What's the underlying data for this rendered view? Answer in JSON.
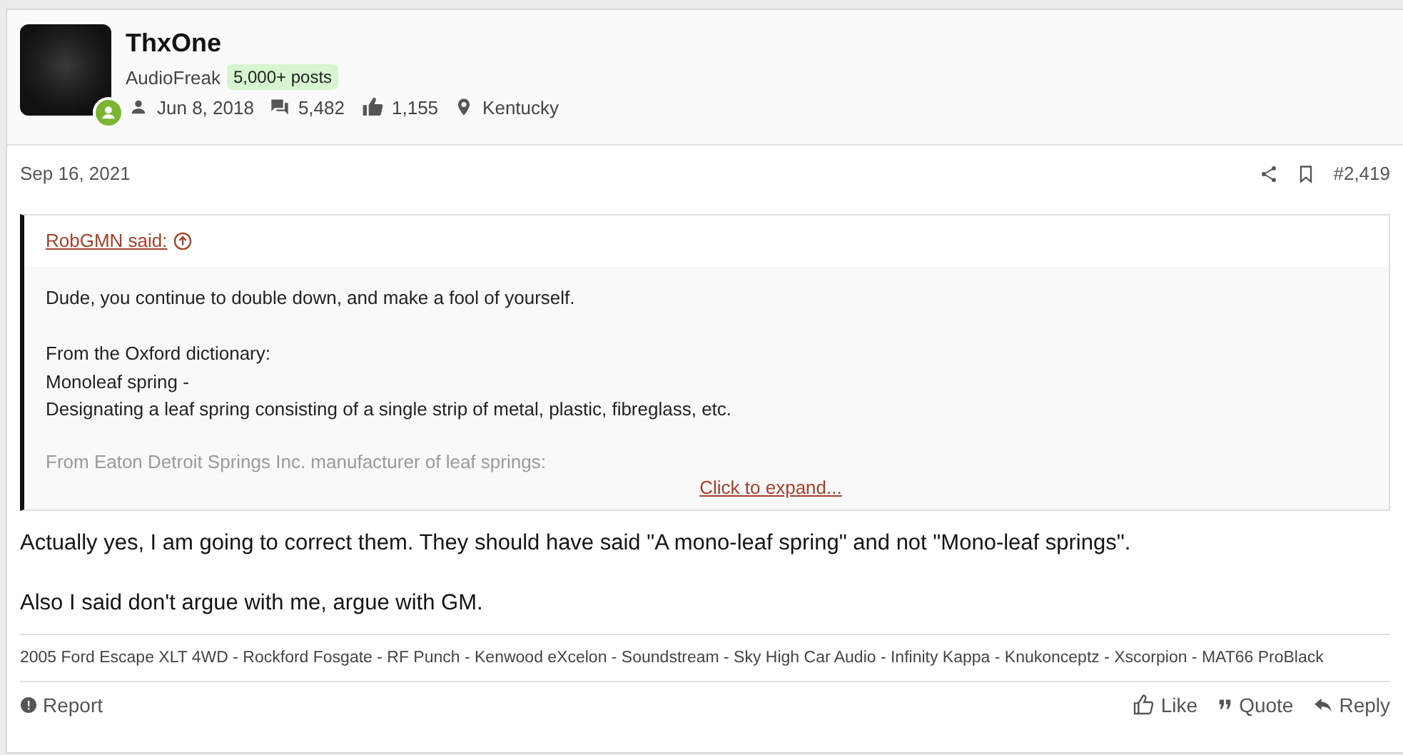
{
  "user": {
    "name": "ThxOne",
    "title": "AudioFreak",
    "badge": "5,000+ posts",
    "online": true,
    "stats": [
      {
        "kind": "joined",
        "text": "Jun 8, 2018"
      },
      {
        "kind": "messages",
        "text": "5,482"
      },
      {
        "kind": "reactions",
        "text": "1,155"
      },
      {
        "kind": "location",
        "text": "Kentucky"
      }
    ]
  },
  "post": {
    "date": "Sep 16, 2021",
    "number": "#2,419",
    "quote": {
      "author": "RobGMN said:",
      "paragraphs": [
        [
          "Dude, you continue to double down, and make a fool of yourself."
        ],
        [
          "From the Oxford dictionary:",
          "Monoleaf spring -",
          "Designating a leaf spring consisting of a single strip of metal, plastic, fibreglass, etc."
        ]
      ],
      "faded_line": "From Eaton Detroit Springs Inc. manufacturer of leaf springs:",
      "expand": "Click to expand..."
    },
    "paragraphs": [
      "Actually yes, I am going to correct them. They should have said \"A mono-leaf spring\" and not \"Mono-leaf springs\".",
      "Also I said don't argue with me, argue with GM."
    ],
    "signature": "2005 Ford Escape XLT 4WD - Rockford Fosgate - RF Punch - Kenwood eXcelon - Soundstream - Sky High Car Audio - Infinity Kappa - Knukonceptz - Xscorpion - MAT66 ProBlack"
  },
  "actions": {
    "left": [
      {
        "kind": "report",
        "label": "Report"
      }
    ],
    "right": [
      {
        "kind": "like",
        "label": "Like"
      },
      {
        "kind": "quote",
        "label": "Quote"
      },
      {
        "kind": "reply",
        "label": "Reply"
      }
    ]
  }
}
